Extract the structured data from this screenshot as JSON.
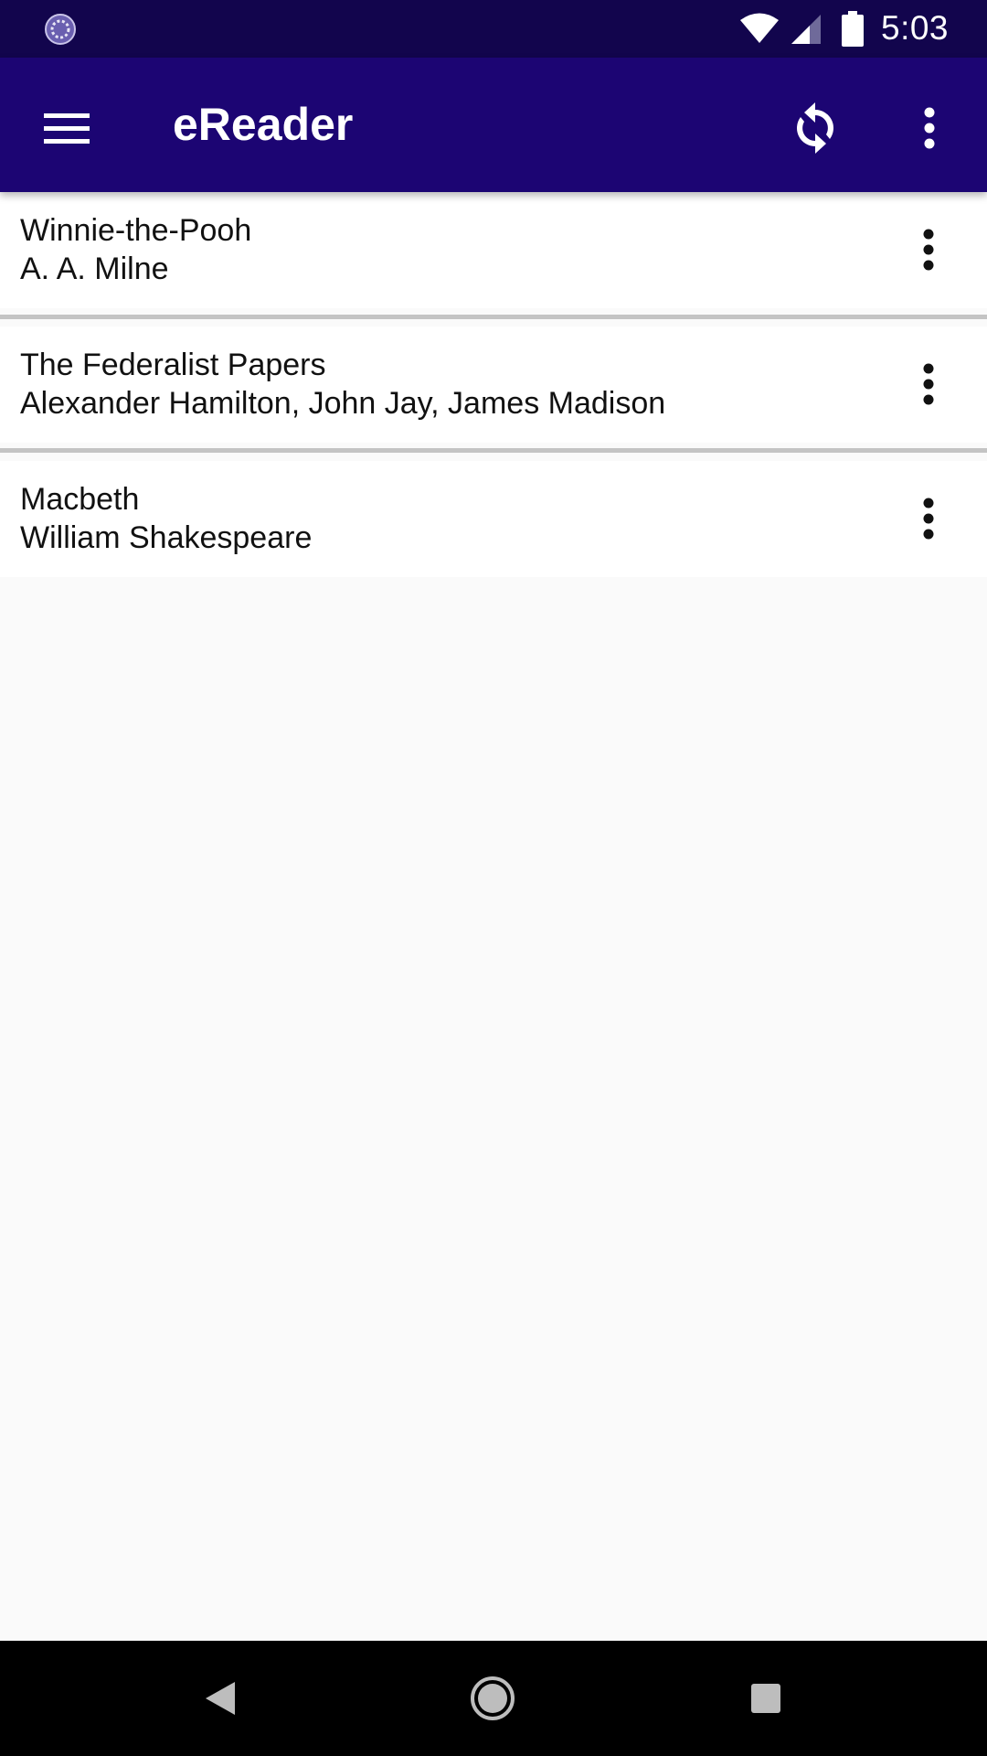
{
  "status_bar": {
    "time": "5:03",
    "icons": [
      "loading-spinner-icon",
      "wifi-icon",
      "cell-signal-icon",
      "battery-icon"
    ]
  },
  "app_bar": {
    "title": "eReader",
    "menu_icon": "hamburger-menu-icon",
    "sync_icon": "sync-icon",
    "overflow_icon": "more-vert-icon",
    "background": "#1c0573"
  },
  "books": [
    {
      "title": "Winnie-the-Pooh",
      "author": "A. A. Milne"
    },
    {
      "title": "The Federalist Papers",
      "author": "Alexander Hamilton, John Jay, James Madison"
    },
    {
      "title": "Macbeth",
      "author": "William Shakespeare"
    }
  ],
  "nav_bar": {
    "icons": [
      "back-icon",
      "home-icon",
      "recents-icon"
    ]
  },
  "colors": {
    "status_bar": "#12054d",
    "app_bar": "#1c0573",
    "background": "#fafafa"
  }
}
